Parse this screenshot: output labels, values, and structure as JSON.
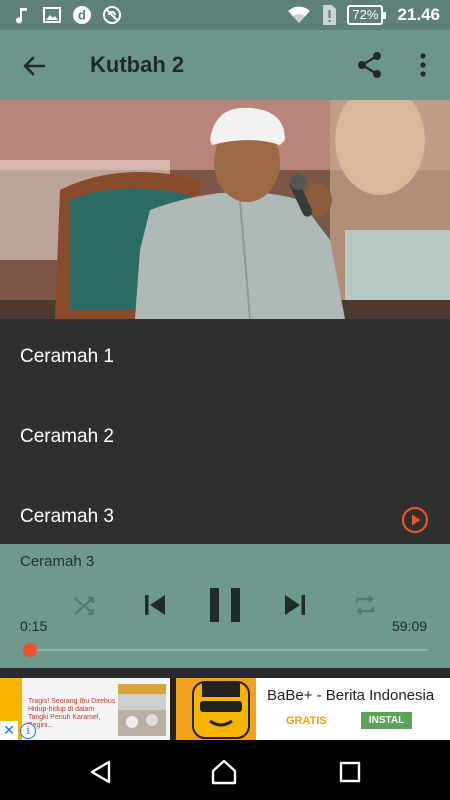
{
  "status_bar": {
    "battery_percent": "72%",
    "time": "21.46",
    "icons": [
      "music-note-icon",
      "image-icon",
      "dailymotion-d-icon",
      "no-sync-icon",
      "wifi-icon",
      "sim-alert-icon",
      "battery-icon"
    ]
  },
  "app_bar": {
    "title": "Kutbah 2",
    "back_icon": "arrow-back-icon",
    "share_icon": "share-icon",
    "more_icon": "more-vert-icon"
  },
  "list": {
    "items": [
      {
        "label": "Ceramah 1"
      },
      {
        "label": "Ceramah 2"
      },
      {
        "label": "Ceramah 3",
        "playing": true
      }
    ]
  },
  "player": {
    "now_playing": "Ceramah 3",
    "current_time": "0:15",
    "total_time": "59:09",
    "progress_fraction": 0.004,
    "controls": [
      "shuffle-icon",
      "skip-previous-icon",
      "pause-icon",
      "skip-next-icon",
      "repeat-icon"
    ]
  },
  "ad": {
    "news_line1": "Tragis! Seorang Ibu Direbus Hidup-hidup di dalam Tangki Penuh Karamel, Begini...",
    "app_name": "BaBe+ - Berita Indonesia",
    "free_label": "GRATIS",
    "install_label": "INSTAL",
    "close_glyph": "✕",
    "info_glyph": "i"
  },
  "colors": {
    "accent": "#e8552a",
    "primary": "#6d958c",
    "primary_dark": "#5e8078",
    "list_bg": "#2f2f2f"
  }
}
